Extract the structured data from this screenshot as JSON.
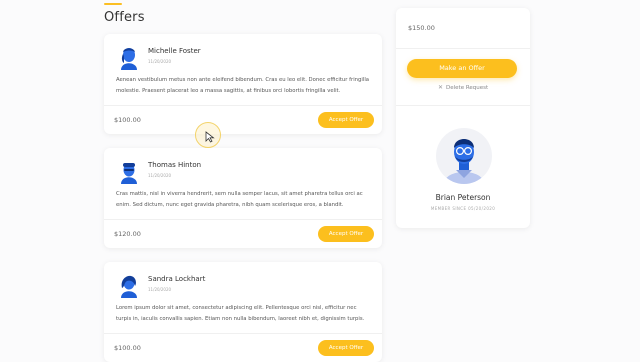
{
  "page": {
    "title": "Offers"
  },
  "offers": [
    {
      "name": "Michelle Foster",
      "date": "11/20/2020",
      "message": "Aenean vestibulum metus non ante eleifend bibendum. Cras eu leo elit. Donec efficitur fringilla molestie. Praesent placerat leo a massa sagittis, at finibus orci lobortis fringilla velit.",
      "price": "$100.00",
      "accept_label": "Accept Offer"
    },
    {
      "name": "Thomas Hinton",
      "date": "11/20/2020",
      "message": "Cras mattis, nisl in viverra hendrerit, sem nulla semper lacus, sit amet pharetra tellus orci ac enim. Sed dictum, nunc eget gravida pharetra, nibh quam scelerisque eros, a blandit.",
      "price": "$120.00",
      "accept_label": "Accept Offer"
    },
    {
      "name": "Sandra Lockhart",
      "date": "11/20/2020",
      "message": "Lorem ipsum dolor sit amet, consectetur adipiscing elit. Pellentesque orci nisl, efficitur nec turpis in, iaculis convallis sapien. Etiam non nulla bibendum, laoreet nibh et, dignissim turpis.",
      "price": "$100.00",
      "accept_label": "Accept Offer"
    }
  ],
  "sidebar": {
    "price": "$150.00",
    "make_offer_label": "Make an Offer",
    "delete_label": "Delete Request",
    "profile_name": "Brian Peterson",
    "member_since": "MEMBER SINCE 05/20/2020"
  },
  "colors": {
    "accent": "#fcbf1e",
    "avatar_blue": "#1f5fd6"
  }
}
